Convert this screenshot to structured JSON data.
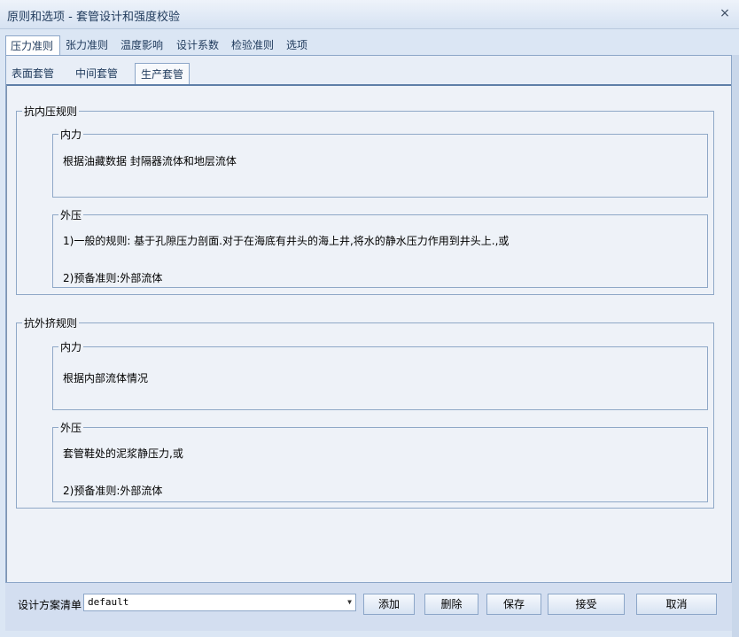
{
  "window": {
    "title": "原则和选项 - 套管设计和强度校验",
    "close_label": "×"
  },
  "tabs1": [
    {
      "label": "压力准则",
      "active": true
    },
    {
      "label": "张力准则"
    },
    {
      "label": "温度影响"
    },
    {
      "label": "设计系数"
    },
    {
      "label": "检验准则"
    },
    {
      "label": "选项"
    }
  ],
  "tabs2": [
    {
      "label": "表面套管"
    },
    {
      "label": "中间套管"
    },
    {
      "label": "生产套管",
      "active": true
    }
  ],
  "burst": {
    "title": "抗内压规则",
    "internal": {
      "title": "内力",
      "line1": "根据油藏数据 封隔器流体和地层流体"
    },
    "external": {
      "title": "外压",
      "line1": "1)一般的规则: 基于孔隙压力剖面.对于在海底有井头的海上井,将水的静水压力作用到井头上.,或",
      "line2": "2)预备准则:外部流体"
    }
  },
  "collapse": {
    "title": "抗外挤规则",
    "internal": {
      "title": "内力",
      "line1": "根据内部流体情况"
    },
    "external": {
      "title": "外压",
      "line1": "套管鞋处的泥浆静压力,或",
      "line2": "2)预备准则:外部流体"
    }
  },
  "bottom": {
    "plan_label": "设计方案清单",
    "plan_value": "default",
    "add": "添加",
    "delete": "删除",
    "save": "保存",
    "accept": "接受",
    "cancel": "取消"
  }
}
